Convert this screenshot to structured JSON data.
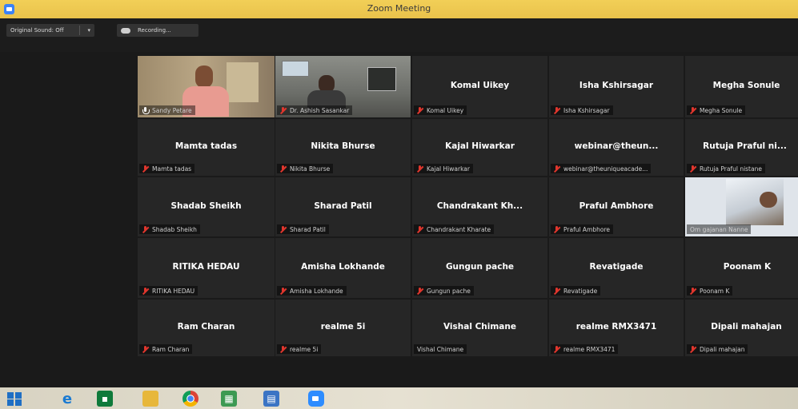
{
  "window": {
    "title": "Zoom Meeting"
  },
  "meeting_bar": {
    "original_sound": "Original Sound: Off",
    "recording": "Recording..."
  },
  "participants": [
    {
      "display": "",
      "tag": "Sandy Petare",
      "video": true
    },
    {
      "display": "",
      "tag": "Dr. Ashish Sasankar",
      "video": true
    },
    {
      "display": "Komal Uikey",
      "tag": "Komal Uikey",
      "video": false
    },
    {
      "display": "Isha Kshirsagar",
      "tag": "Isha Kshirsagar",
      "video": false
    },
    {
      "display": "Megha Sonule",
      "tag": "Megha Sonule",
      "video": false
    },
    {
      "display": "Mamta tadas",
      "tag": "Mamta tadas",
      "video": false
    },
    {
      "display": "Nikita Bhurse",
      "tag": "Nikita Bhurse",
      "video": false
    },
    {
      "display": "Kajal Hiwarkar",
      "tag": "Kajal Hiwarkar",
      "video": false
    },
    {
      "display": "webinar@theun...",
      "tag": "webinar@theuniqueacade...",
      "video": false
    },
    {
      "display": "Rutuja Praful ni...",
      "tag": "Rutuja Praful nistane",
      "video": false
    },
    {
      "display": "Shadab Sheikh",
      "tag": "Shadab Sheikh",
      "video": false
    },
    {
      "display": "Sharad Patil",
      "tag": "Sharad Patil",
      "video": false
    },
    {
      "display": "Chandrakant Kh...",
      "tag": "Chandrakant Kharate",
      "video": false
    },
    {
      "display": "Praful Ambhore",
      "tag": "Praful Ambhore",
      "video": false
    },
    {
      "display": "",
      "tag": "Om gajanan Nanne",
      "video": true
    },
    {
      "display": "RITIKA HEDAU",
      "tag": "RITIKA HEDAU",
      "video": false
    },
    {
      "display": "Amisha Lokhande",
      "tag": "Amisha Lokhande",
      "video": false
    },
    {
      "display": "Gungun pache",
      "tag": "Gungun pache",
      "video": false
    },
    {
      "display": "Revatigade",
      "tag": "Revatigade",
      "video": false
    },
    {
      "display": "Poonam K",
      "tag": "Poonam K",
      "video": false
    },
    {
      "display": "Ram Charan",
      "tag": "Ram Charan",
      "video": false
    },
    {
      "display": "realme 5i",
      "tag": "realme 5i",
      "video": false
    },
    {
      "display": "Vishal Chimane",
      "tag": "Vishal Chimane",
      "video": false
    },
    {
      "display": "realme RMX3471",
      "tag": "realme RMX3471",
      "video": false
    },
    {
      "display": "Dipali mahajan",
      "tag": "Dipali mahajan",
      "video": false
    }
  ],
  "taskbar_icons": [
    "windows-start-icon",
    "internet-explorer-icon",
    "store-icon",
    "file-explorer-icon",
    "chrome-icon",
    "calculator-icon",
    "app-icon",
    "zoom-icon"
  ],
  "colors": {
    "title_bar": "#f0cc55",
    "active_speaker_border": "#d2e34a",
    "mute_red": "#e0362d",
    "tile_bg": "#262626"
  }
}
